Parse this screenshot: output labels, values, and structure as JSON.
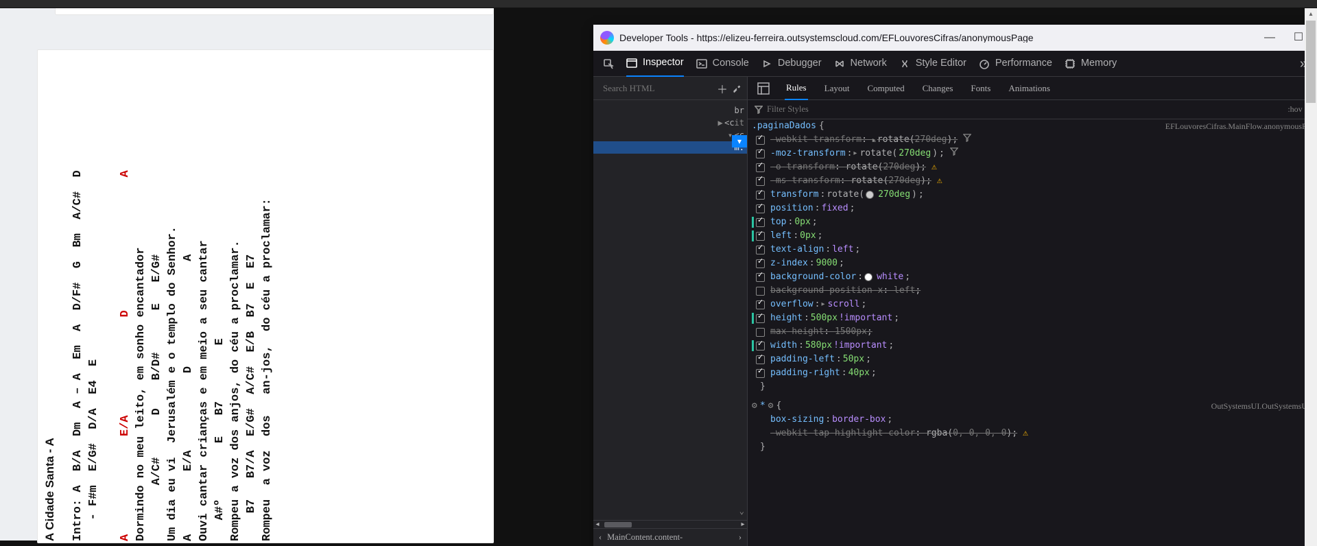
{
  "song": {
    "title": "A Cidade Santa - A",
    "lines": [
      {
        "t": "chord",
        "txt": "Intro: A  B/A  Dm  A – A  Em  A  D/F#  G  Bm  A/C#  D"
      },
      {
        "t": "chord",
        "txt": "   - F#m  E/G#  D/A  E4  E"
      },
      {
        "t": "gap"
      },
      {
        "t": "red",
        "txt": "A              E/A              D                   A"
      },
      {
        "t": "lyr",
        "txt": "Dormindo no meu leito, em sonho encantador"
      },
      {
        "t": "chord",
        "txt": "        A/C#      D    B/D#      E   E/G#"
      },
      {
        "t": "lyr",
        "txt": "Um dia eu vi  Jerusalém e o templo do Senhor."
      },
      {
        "t": "chord",
        "txt": "A         E/A           D               A"
      },
      {
        "t": "lyr",
        "txt": "Ouvi cantar crianças e em meio a seu cantar"
      },
      {
        "t": "chord",
        "txt": "   A#º        E   B7        E"
      },
      {
        "t": "lyr",
        "txt": "Rompeu a voz dos anjos, do céu a proclamar."
      },
      {
        "t": "chord",
        "txt": "    B7   B7/A  E/G#  A/C#  E/B  B7  E  E7"
      },
      {
        "t": "lyr",
        "txt": "Rompeu  a voz  dos   an-jos,  do céu a proclamar:"
      }
    ]
  },
  "devtools": {
    "windowTitle": "Developer Tools - https://elizeu-ferreira.outsystemscloud.com/EFLouvoresCifras/anonymousPage",
    "mainTabs": [
      "Inspector",
      "Console",
      "Debugger",
      "Network",
      "Style Editor",
      "Performance",
      "Memory"
    ],
    "activeMainTab": "Inspector",
    "searchPlaceholder": "Search HTML",
    "domLines": [
      {
        "indent": 0,
        "tw": "",
        "txt": "br"
      },
      {
        "indent": 0,
        "tw": "▶",
        "txt": "<c",
        "cut": true,
        "itlabel": "it"
      },
      {
        "indent": 0,
        "tw": "▾",
        "txt": "<c"
      },
      {
        "indent": 1,
        "tw": "",
        "txt": "m:",
        "cut": true
      }
    ],
    "breadcrumb": "MainContent.content-",
    "subTabs": [
      "Rules",
      "Layout",
      "Computed",
      "Changes",
      "Fonts",
      "Animations"
    ],
    "activeSubTab": "Rules",
    "filterPlaceholder": "Filter Styles",
    "hov": ":hov  .c",
    "ruleBlocks": [
      {
        "selector": ".paginaDados",
        "source": "EFLouvoresCifras.MainFlow.anonymousPa",
        "decls": [
          {
            "checked": true,
            "bar": false,
            "strike": true,
            "prop": "-webkit-transform",
            "valparts": [
              [
                "exp",
                "▸"
              ],
              [
                "fx",
                "rotate("
              ],
              [
                "num",
                "270deg"
              ],
              [
                "fx",
                ")"
              ]
            ],
            "trailer": "filt"
          },
          {
            "checked": true,
            "bar": false,
            "strike": false,
            "prop": "-moz-transform",
            "valparts": [
              [
                "exp",
                "▸"
              ],
              [
                "fx",
                "rotate("
              ],
              [
                "num",
                "270deg"
              ],
              [
                "fx",
                ")"
              ]
            ],
            "trailer": "filt"
          },
          {
            "checked": true,
            "bar": false,
            "strike": true,
            "prop": "-o-transform",
            "valparts": [
              [
                "fx",
                "rotate("
              ],
              [
                "num",
                "270deg"
              ],
              [
                "fx",
                ")"
              ]
            ],
            "trailer": "warn"
          },
          {
            "checked": true,
            "bar": false,
            "strike": true,
            "prop": "-ms-transform",
            "valparts": [
              [
                "fx",
                "rotate("
              ],
              [
                "num",
                "270deg"
              ],
              [
                "fx",
                ")"
              ]
            ],
            "trailer": "warn"
          },
          {
            "checked": true,
            "bar": false,
            "strike": false,
            "prop": "transform",
            "valparts": [
              [
                "fx",
                "rotate("
              ],
              [
                "swatch",
                "#ccc"
              ],
              [
                "num",
                " 270deg"
              ],
              [
                "fx",
                ")"
              ]
            ],
            "trailer": ""
          },
          {
            "checked": true,
            "bar": false,
            "strike": false,
            "prop": "position",
            "valparts": [
              [
                "kw",
                "fixed"
              ]
            ],
            "trailer": ""
          },
          {
            "checked": true,
            "bar": true,
            "strike": false,
            "prop": "top",
            "valparts": [
              [
                "num",
                "0px"
              ]
            ],
            "trailer": ""
          },
          {
            "checked": true,
            "bar": true,
            "strike": false,
            "prop": "left",
            "valparts": [
              [
                "num",
                "0px"
              ]
            ],
            "trailer": ""
          },
          {
            "checked": true,
            "bar": false,
            "strike": false,
            "prop": "text-align",
            "valparts": [
              [
                "kw",
                "left"
              ]
            ],
            "trailer": ""
          },
          {
            "checked": true,
            "bar": false,
            "strike": false,
            "prop": "z-index",
            "valparts": [
              [
                "num",
                "9000"
              ]
            ],
            "trailer": ""
          },
          {
            "checked": true,
            "bar": false,
            "strike": false,
            "prop": "background-color",
            "valparts": [
              [
                "swatch",
                "#fff"
              ],
              [
                "kw",
                " white"
              ]
            ],
            "trailer": ""
          },
          {
            "checked": false,
            "bar": false,
            "strike": true,
            "prop": "background-position-x",
            "valparts": [
              [
                "kw",
                "left"
              ]
            ],
            "trailer": ""
          },
          {
            "checked": true,
            "bar": false,
            "strike": false,
            "prop": "overflow",
            "valparts": [
              [
                "exp",
                "▸"
              ],
              [
                "kw",
                "scroll"
              ]
            ],
            "trailer": ""
          },
          {
            "checked": true,
            "bar": true,
            "strike": false,
            "prop": "height",
            "valparts": [
              [
                "num",
                "500px"
              ],
              [
                "kw",
                " !important"
              ]
            ],
            "trailer": ""
          },
          {
            "checked": false,
            "bar": false,
            "strike": true,
            "prop": "max-height",
            "valparts": [
              [
                "num",
                "1500px"
              ]
            ],
            "trailer": ""
          },
          {
            "checked": true,
            "bar": true,
            "strike": false,
            "prop": "width",
            "valparts": [
              [
                "num",
                "580px"
              ],
              [
                "kw",
                " !important"
              ]
            ],
            "trailer": ""
          },
          {
            "checked": true,
            "bar": false,
            "strike": false,
            "prop": "padding-left",
            "valparts": [
              [
                "num",
                "50px"
              ]
            ],
            "trailer": ""
          },
          {
            "checked": true,
            "bar": false,
            "strike": false,
            "prop": "padding-right",
            "valparts": [
              [
                "num",
                "40px"
              ]
            ],
            "trailer": ""
          }
        ]
      },
      {
        "selector": "*",
        "source": "OutSystemsUI.OutSystemsUI",
        "gear": true,
        "decls": [
          {
            "checked": null,
            "bar": false,
            "strike": false,
            "prop": "box-sizing",
            "valparts": [
              [
                "kw",
                "border-box"
              ]
            ],
            "trailer": ""
          },
          {
            "checked": null,
            "bar": false,
            "strike": true,
            "prop": "-webkit-tap-highlight-color",
            "valparts": [
              [
                "fx",
                "rgba("
              ],
              [
                "num",
                "0, 0, 0, 0"
              ],
              [
                "fx",
                ")"
              ]
            ],
            "trailer": "warn"
          }
        ]
      }
    ]
  }
}
